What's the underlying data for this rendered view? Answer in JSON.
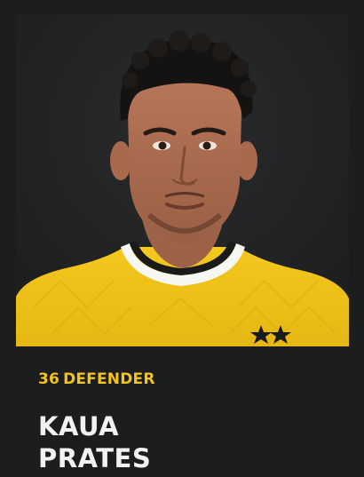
{
  "player": {
    "number": "36",
    "position": "DEFENDER",
    "first_name": "KAUA",
    "last_name": "PRATES",
    "photo_icon": "player-portrait-image"
  },
  "colors": {
    "background": "#1b1d1e",
    "accent": "#f3c41e",
    "name": "#f2f2f2",
    "jersey": "#f2c21b"
  }
}
